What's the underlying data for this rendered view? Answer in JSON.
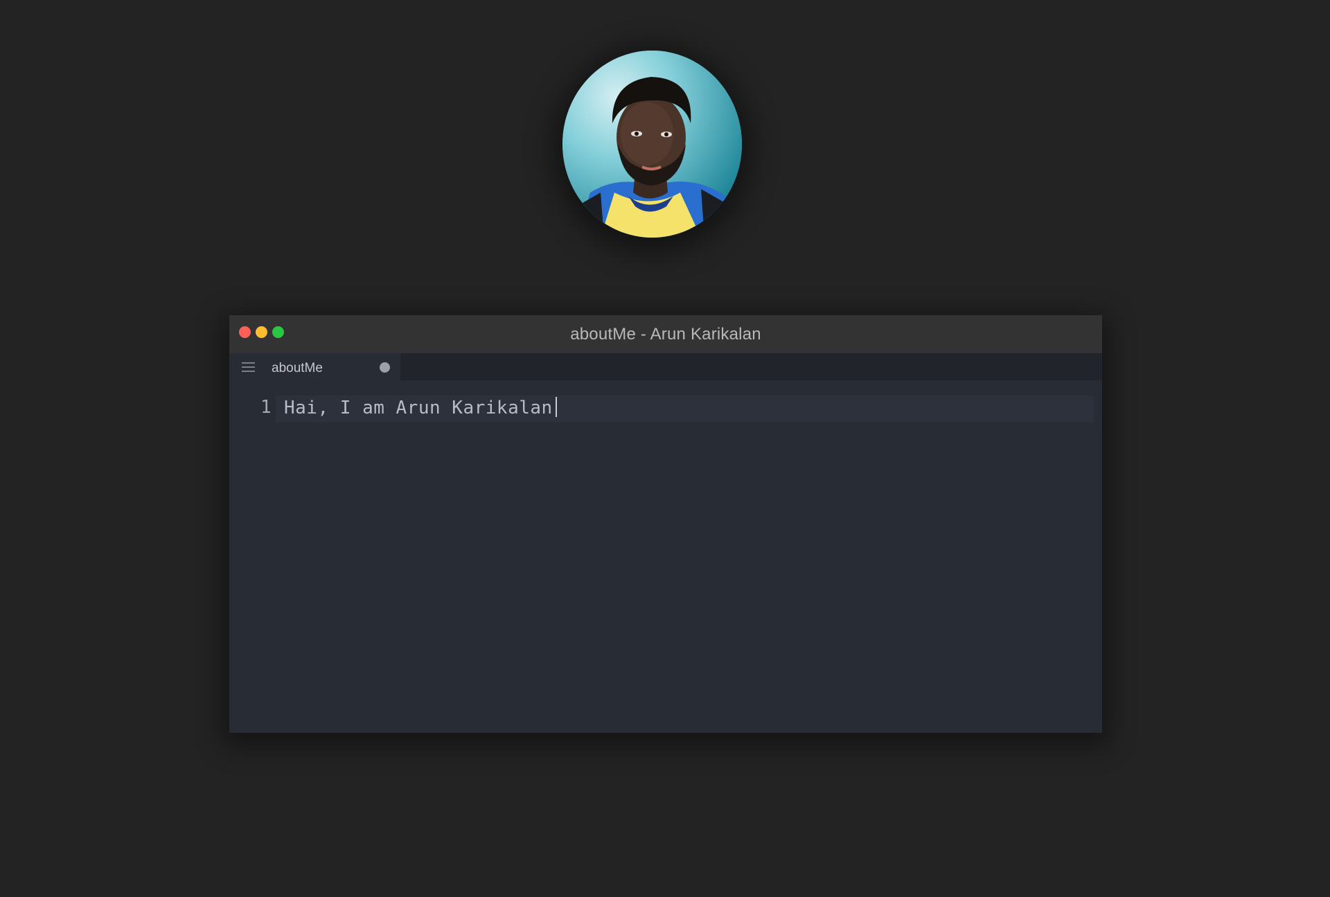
{
  "window": {
    "title": "aboutMe - Arun Karikalan"
  },
  "tab": {
    "label": "aboutMe"
  },
  "editor": {
    "line_number": "1",
    "line_text": "Hai, I am Arun Karikalan"
  },
  "icons": {
    "menu": "hamburger-icon",
    "modified": "unsaved-dot-icon"
  },
  "colors": {
    "background": "#232324",
    "titlebar": "#333334",
    "editor_bg": "#282c35",
    "traffic_close": "#fe5f57",
    "traffic_minimize": "#febc2e",
    "traffic_maximize": "#28c840"
  }
}
